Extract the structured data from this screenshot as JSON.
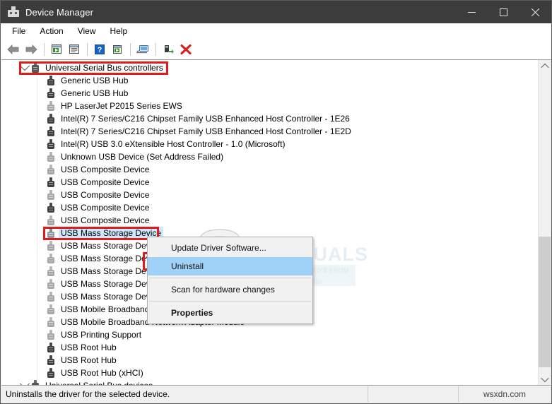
{
  "window": {
    "title": "Device Manager",
    "icon": "device-manager-icon",
    "controls": {
      "minimize": "–",
      "maximize": "□",
      "close": "✕"
    }
  },
  "menubar": {
    "items": [
      "File",
      "Action",
      "View",
      "Help"
    ]
  },
  "toolbar": {
    "buttons": [
      {
        "name": "back-icon",
        "title": "Back"
      },
      {
        "name": "forward-icon",
        "title": "Forward"
      },
      {
        "name": "separator",
        "title": ""
      },
      {
        "name": "properties-icon",
        "title": "Properties"
      },
      {
        "name": "show-hide-console-tree-icon",
        "title": "Show/Hide Console Tree"
      },
      {
        "name": "separator",
        "title": ""
      },
      {
        "name": "help-icon",
        "title": "Help"
      },
      {
        "name": "update-driver-icon",
        "title": "Update Driver Software"
      },
      {
        "name": "separator",
        "title": ""
      },
      {
        "name": "scan-hardware-changes-icon",
        "title": "Scan for hardware changes"
      },
      {
        "name": "separator",
        "title": ""
      },
      {
        "name": "enable-device-icon",
        "title": "Enable device"
      },
      {
        "name": "uninstall-device-icon",
        "title": "Uninstall device"
      }
    ]
  },
  "tree": {
    "root": {
      "label": "Universal Serial Bus controllers",
      "expanded": true,
      "icon": "usb-controller-icon",
      "highlighted": true
    },
    "children": [
      {
        "label": "Generic USB Hub",
        "icon": "usb-device-icon",
        "tone": "dark"
      },
      {
        "label": "Generic USB Hub",
        "icon": "usb-device-icon",
        "tone": "dark"
      },
      {
        "label": "HP LaserJet P2015 Series EWS",
        "icon": "usb-device-icon",
        "tone": "light"
      },
      {
        "label": "Intel(R) 7 Series/C216 Chipset Family USB Enhanced Host Controller - 1E26",
        "icon": "usb-device-icon",
        "tone": "dark"
      },
      {
        "label": "Intel(R) 7 Series/C216 Chipset Family USB Enhanced Host Controller - 1E2D",
        "icon": "usb-device-icon",
        "tone": "dark"
      },
      {
        "label": "Intel(R) USB 3.0 eXtensible Host Controller - 1.0 (Microsoft)",
        "icon": "usb-device-icon",
        "tone": "dark"
      },
      {
        "label": "Unknown USB Device (Set Address Failed)",
        "icon": "usb-device-icon",
        "tone": "light"
      },
      {
        "label": "USB Composite Device",
        "icon": "usb-device-icon",
        "tone": "light"
      },
      {
        "label": "USB Composite Device",
        "icon": "usb-device-icon",
        "tone": "dark"
      },
      {
        "label": "USB Composite Device",
        "icon": "usb-device-icon",
        "tone": "light"
      },
      {
        "label": "USB Composite Device",
        "icon": "usb-device-icon",
        "tone": "dark"
      },
      {
        "label": "USB Composite Device",
        "icon": "usb-device-icon",
        "tone": "light"
      },
      {
        "label": "USB Mass Storage Device",
        "icon": "usb-device-icon",
        "tone": "sel",
        "selected": true
      },
      {
        "label": "USB Mass Storage Device",
        "icon": "usb-device-icon",
        "tone": "light"
      },
      {
        "label": "USB Mass Storage Device",
        "icon": "usb-device-icon",
        "tone": "light"
      },
      {
        "label": "USB Mass Storage Device",
        "icon": "usb-device-icon",
        "tone": "light"
      },
      {
        "label": "USB Mass Storage Device",
        "icon": "usb-device-icon",
        "tone": "light"
      },
      {
        "label": "USB Mass Storage Device",
        "icon": "usb-device-icon",
        "tone": "light"
      },
      {
        "label": "USB Mobile Broadband",
        "icon": "usb-device-icon",
        "tone": "light"
      },
      {
        "label": "USB Mobile Broadband Network Adapter Module",
        "icon": "usb-device-icon",
        "tone": "light"
      },
      {
        "label": "USB Printing Support",
        "icon": "usb-device-icon",
        "tone": "light"
      },
      {
        "label": "USB Root Hub",
        "icon": "usb-device-icon",
        "tone": "dark"
      },
      {
        "label": "USB Root Hub",
        "icon": "usb-device-icon",
        "tone": "dark"
      },
      {
        "label": "USB Root Hub (xHCI)",
        "icon": "usb-device-icon",
        "tone": "dark"
      }
    ],
    "next_group": {
      "label": "Universal Serial Bus devices",
      "expanded": true,
      "icon": "usb-device-group-icon"
    }
  },
  "context_menu": {
    "items": [
      {
        "label": "Update Driver Software...",
        "bold": false,
        "highlighted": false
      },
      {
        "label": "Uninstall",
        "bold": false,
        "highlighted": true
      },
      {
        "label": "Scan for hardware changes",
        "bold": false,
        "highlighted": false
      },
      {
        "label": "Properties",
        "bold": true,
        "highlighted": false
      }
    ]
  },
  "statusbar": {
    "message": "Uninstalls the driver for the selected device.",
    "middle": "",
    "watermark": "wsxdn.com"
  },
  "watermark": {
    "brand": "APPUALS",
    "tagline_line1": "TECH HOW-TO'S FROM",
    "tagline_line2": "THE EXPERTS!"
  },
  "colors": {
    "titlebar": "#3c3c3c",
    "selection": "#cce8ff",
    "menu_highlight": "#9fd2f6",
    "annotation_red": "#e01b1b",
    "window_bg": "#f0f0f0"
  }
}
